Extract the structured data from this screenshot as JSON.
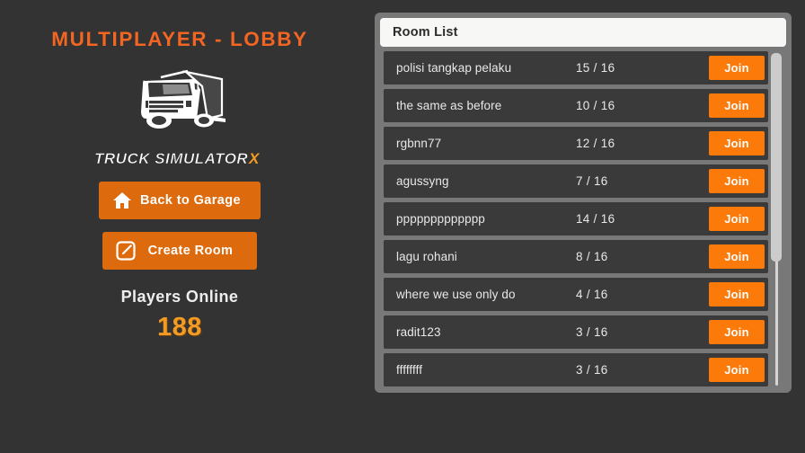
{
  "lobby": {
    "title": "MULTIPLAYER - LOBBY",
    "logo_wordmark": "TRUCK SIMULATOR X",
    "logo_wordmark_main": "TRUCK SIMULATOR",
    "logo_wordmark_accent": "X",
    "truck_icon": "truck-icon",
    "buttons": [
      {
        "label": "Back to Garage",
        "icon": "home-icon"
      },
      {
        "label": "Create Room",
        "icon": "edit-square-icon"
      }
    ],
    "players_online_label": "Players Online",
    "players_online_count": "188"
  },
  "room_panel": {
    "title": "Room List",
    "join_label": "Join",
    "rooms": [
      {
        "name": "polisi tangkap pelaku",
        "capacity": "15 / 16"
      },
      {
        "name": "the same as before",
        "capacity": "10 / 16"
      },
      {
        "name": "rgbnn77",
        "capacity": "12 / 16"
      },
      {
        "name": "agussyng",
        "capacity": "7 / 16"
      },
      {
        "name": "ppppppppppppp",
        "capacity": "14 / 16"
      },
      {
        "name": "lagu rohani",
        "capacity": "8 / 16"
      },
      {
        "name": "where we use only do",
        "capacity": "4 / 16"
      },
      {
        "name": "radit123",
        "capacity": "3 / 16"
      },
      {
        "name": "ffffffff",
        "capacity": "3 / 16"
      }
    ]
  },
  "colors": {
    "background": "#333333",
    "accent_orange": "#F26522",
    "button_orange": "#DD6B0D",
    "join_orange": "#FC7A0A",
    "panel_gray": "#787878",
    "row_gray": "#3A3A3A",
    "count_orange": "#F59A23",
    "header_white": "#F7F7F5"
  }
}
